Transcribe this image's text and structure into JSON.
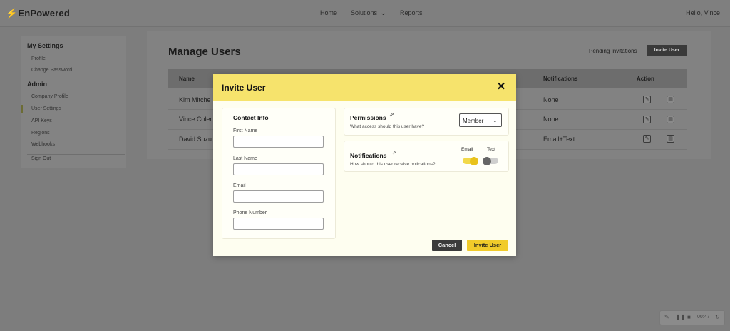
{
  "header": {
    "logo_text": "EnPowered",
    "nav": {
      "home": "Home",
      "solutions": "Solutions",
      "reports": "Reports"
    },
    "greeting": "Hello, Vince"
  },
  "sidebar": {
    "my_settings_heading": "My Settings",
    "profile": "Profile",
    "change_password": "Change Password",
    "admin_heading": "Admin",
    "company_profile": "Company Profile",
    "user_settings": "User Settings",
    "api_keys": "API Keys",
    "regions": "Regions",
    "webhooks": "Webhooks",
    "sign_out": "Sign Out"
  },
  "main": {
    "title": "Manage Users",
    "pending_invitations": "Pending Invitations",
    "invite_user_button": "Invite User",
    "columns": {
      "name": "Name",
      "notifications": "Notifications",
      "action": "Action"
    },
    "rows": [
      {
        "name": "Kim Mitche",
        "notifications": "None"
      },
      {
        "name": "Vince Coler",
        "notifications": "None"
      },
      {
        "name": "David Suzu",
        "notifications": "Email+Text"
      }
    ]
  },
  "modal": {
    "title": "Invite User",
    "close": "✕",
    "contact": {
      "title": "Contact Info",
      "first_name_label": "First Name",
      "last_name_label": "Last Name",
      "email_label": "Email",
      "phone_label": "Phone Number",
      "first_name_value": "",
      "last_name_value": "",
      "email_value": "",
      "phone_value": ""
    },
    "permissions": {
      "title": "Permissions",
      "subtitle": "What access should this user have?",
      "selected": "Member"
    },
    "notifications": {
      "title": "Notifications",
      "subtitle": "How should this user receive notications?",
      "email_label": "Email",
      "text_label": "Text",
      "email_on": true,
      "text_on": false
    },
    "cancel_button": "Cancel",
    "invite_button": "Invite User"
  },
  "recorder": {
    "time": "00:47"
  },
  "colors": {
    "accent_yellow": "#f6e36c",
    "primary_button": "#f1cb2a",
    "dark_button": "#3b3b3b"
  }
}
